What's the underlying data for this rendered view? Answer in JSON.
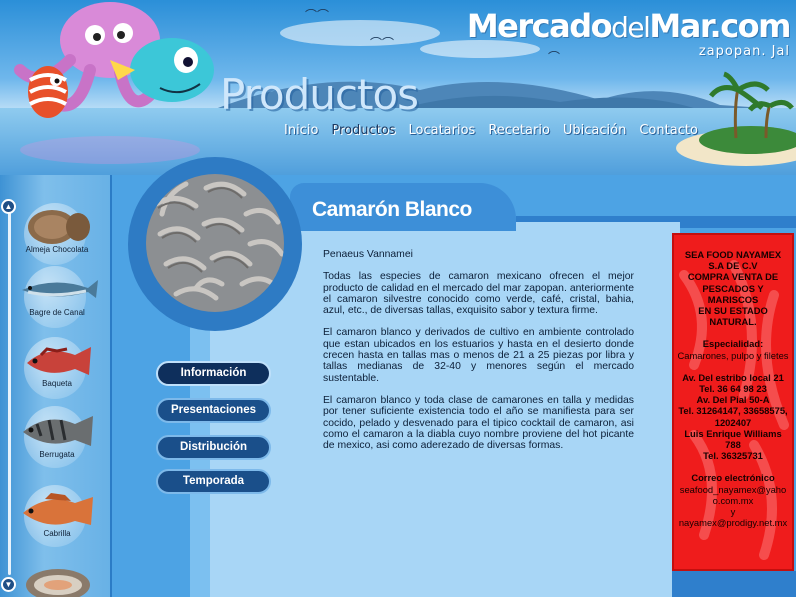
{
  "brand": {
    "title_bold": "Mercado",
    "title_mid": "del",
    "title_end": "Mar.com",
    "subtitle": "zapopan. Jal"
  },
  "section_title": "Productos",
  "nav": [
    {
      "label": "Inicio"
    },
    {
      "label": "Productos"
    },
    {
      "label": "Locatarios"
    },
    {
      "label": "Recetario"
    },
    {
      "label": "Ubicación"
    },
    {
      "label": "Contacto"
    }
  ],
  "products": [
    {
      "label": "Almeja Chocolata",
      "icon": "clam-icon"
    },
    {
      "label": "Bagre de Canal",
      "icon": "catfish-icon"
    },
    {
      "label": "Baqueta",
      "icon": "red-grouper-icon"
    },
    {
      "label": "Berrugata",
      "icon": "croaker-icon"
    },
    {
      "label": "Cabrilla",
      "icon": "sea-bass-icon"
    },
    {
      "label": "",
      "icon": "shellfish-icon"
    }
  ],
  "product": {
    "title": "Camarón Blanco",
    "scientific": "Penaeus Vannamei",
    "paragraphs": [
      "Todas las especies de camaron mexicano ofrecen el mejor producto de calidad en el mercado del mar zapopan. anteriormente el camaron silvestre conocido como verde, café, cristal, bahia, azul, etc., de diversas tallas, exquisito sabor y textura firme.",
      "El camaron blanco y derivados de cultivo en ambiente controlado que estan ubicados en los estuarios y hasta en el desierto donde crecen hasta en tallas mas o menos de 21 a 25 piezas por libra y tallas medianas de 32-40 y menores según el mercado sustentable.",
      "El camaron blanco y toda clase de camarones en talla y medidas por tener suficiente existencia todo el año se manifiesta para ser cocido, pelado y desvenado para el tipico cocktail de camaron, asi como el camaron a la diabla cuyo nombre proviene del hot picante de mexico, asi como aderezado de diversas formas."
    ]
  },
  "menu": [
    {
      "label": "Información"
    },
    {
      "label": "Presentaciones"
    },
    {
      "label": "Distribución"
    },
    {
      "label": "Temporada"
    }
  ],
  "info_box": {
    "company": [
      "SEA FOOD NAYAMEX",
      "S.A DE C.V",
      "COMPRA VENTA DE",
      "PESCADOS Y",
      "MARISCOS",
      "EN SU ESTADO",
      "NATURAL."
    ],
    "specialty_label": "Especialidad:",
    "specialty_value": "Camarones, pulpo y filetes",
    "address": [
      "Av. Del estribo local 21",
      "Tel. 36 64 98 23",
      "Av. Del Pial 50-A",
      "Tel. 31264147, 33658575,",
      "1202407",
      "Luis Enrique Williams 788",
      "Tel.  36325731"
    ],
    "email_label": "Correo electrónico",
    "email_1": "seafood_nayamex@yahoo.com.mx",
    "email_join": "y",
    "email_2": "nayamex@prodigy.net.mx"
  },
  "colors": {
    "sky": "#5aa9e6",
    "panel": "#a8d6f6",
    "menu_button": "#1a4f8a",
    "info_box": "#ef1c1c"
  }
}
